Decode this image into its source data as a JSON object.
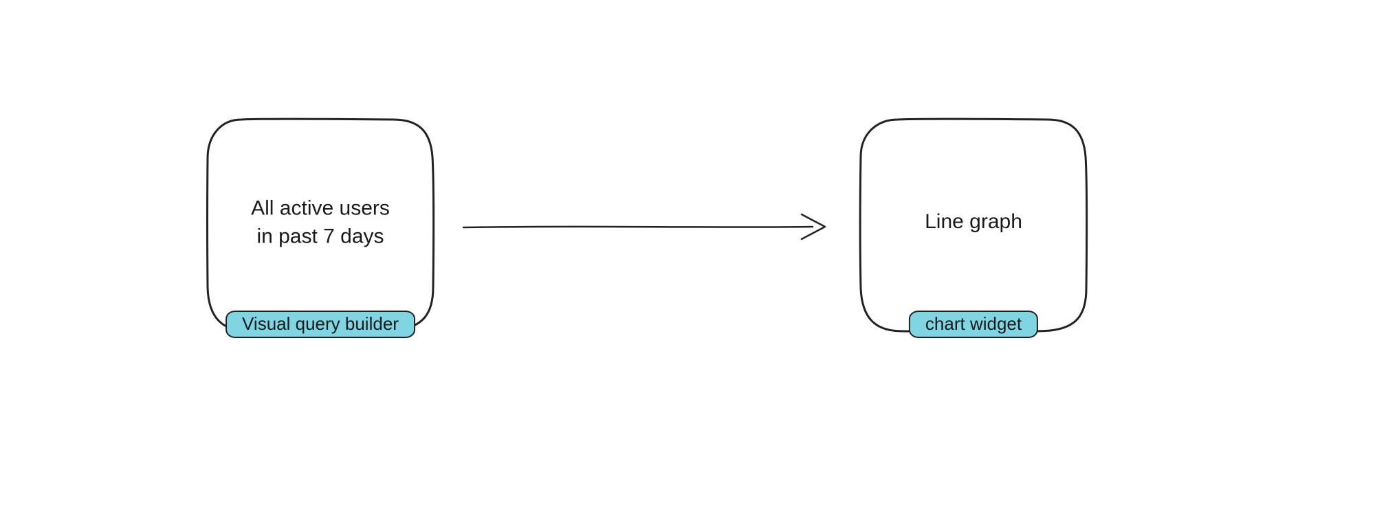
{
  "nodes": {
    "left": {
      "text": "All active users\nin past 7 days",
      "tag": "Visual query builder"
    },
    "right": {
      "text": "Line graph",
      "tag": "chart widget"
    }
  }
}
